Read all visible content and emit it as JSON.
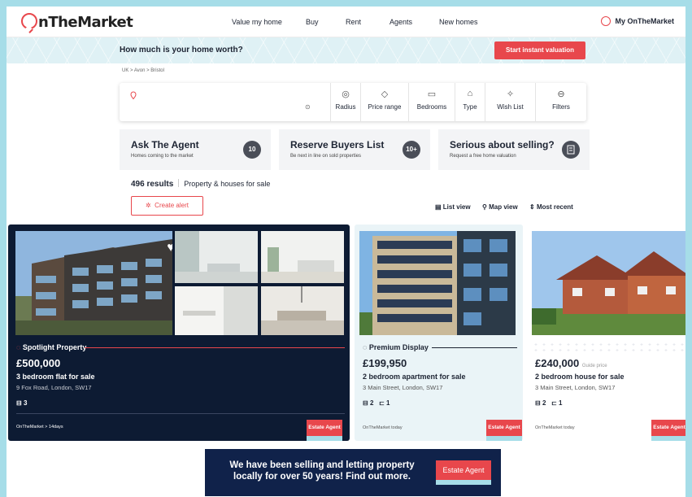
{
  "header": {
    "logo_text": "OnTheMarket",
    "nav": [
      "Value my home",
      "Buy",
      "Rent",
      "Agents",
      "New homes"
    ],
    "account_label": "My OnTheMarket"
  },
  "valuation": {
    "question": "How much is your home worth?",
    "button_label": "Start instant valuation"
  },
  "breadcrumb": "UK > Avon > Bristol",
  "search": {
    "filters": [
      {
        "label": "Radius",
        "icon": "radius-icon"
      },
      {
        "label": "Price range",
        "icon": "tag-icon"
      },
      {
        "label": "Bedrooms",
        "icon": "bed-icon"
      },
      {
        "label": "Type",
        "icon": "house-icon"
      },
      {
        "label": "Wish List",
        "icon": "sparkle-icon"
      },
      {
        "label": "Filters",
        "icon": "filter-icon"
      }
    ]
  },
  "promo_cards": [
    {
      "title": "Ask The Agent",
      "subtitle": "Homes coming to the market",
      "badge": "10"
    },
    {
      "title": "Reserve Buyers List",
      "subtitle": "Be next in line on sold properties",
      "badge": "10+"
    },
    {
      "title": "Serious about selling?",
      "subtitle": "Request a free home valuation",
      "badge": ""
    }
  ],
  "results": {
    "count": "496 results",
    "description": "Property & houses for sale",
    "create_alert": "Create alert",
    "list_view": "List view",
    "map_view": "Map view",
    "sort": "Most recent"
  },
  "listings": [
    {
      "tag": "Spotlight Property",
      "price": "£500,000",
      "price_note": "",
      "title": "3 bedroom flat for sale",
      "address": "9 Fox Road, London, SW17",
      "beds": "3",
      "baths": "",
      "meta": "OnTheMarket > 14days",
      "agent_button": "Estate Agent"
    },
    {
      "tag": "Premium Display",
      "price": "£199,950",
      "price_note": "",
      "title": "2 bedroom apartment for sale",
      "address": "3 Main Street, London, SW17",
      "beds": "2",
      "baths": "1",
      "meta": "OnTheMarket today",
      "agent_button": "Estate Agent"
    },
    {
      "tag": "",
      "price": "£240,000",
      "price_note": "Guide price",
      "title": "2 bedroom house for sale",
      "address": "3 Main Street, London, SW17",
      "beds": "2",
      "baths": "1",
      "meta": "OnTheMarket today",
      "agent_button": "Estate Agent"
    }
  ],
  "banner": {
    "text": "We have been selling and letting property locally for over 50 years! Find out more.",
    "button": "Estate Agent"
  },
  "colors": {
    "accent": "#e8474c",
    "navy": "#0d1b33",
    "frame": "#a6dde8"
  }
}
